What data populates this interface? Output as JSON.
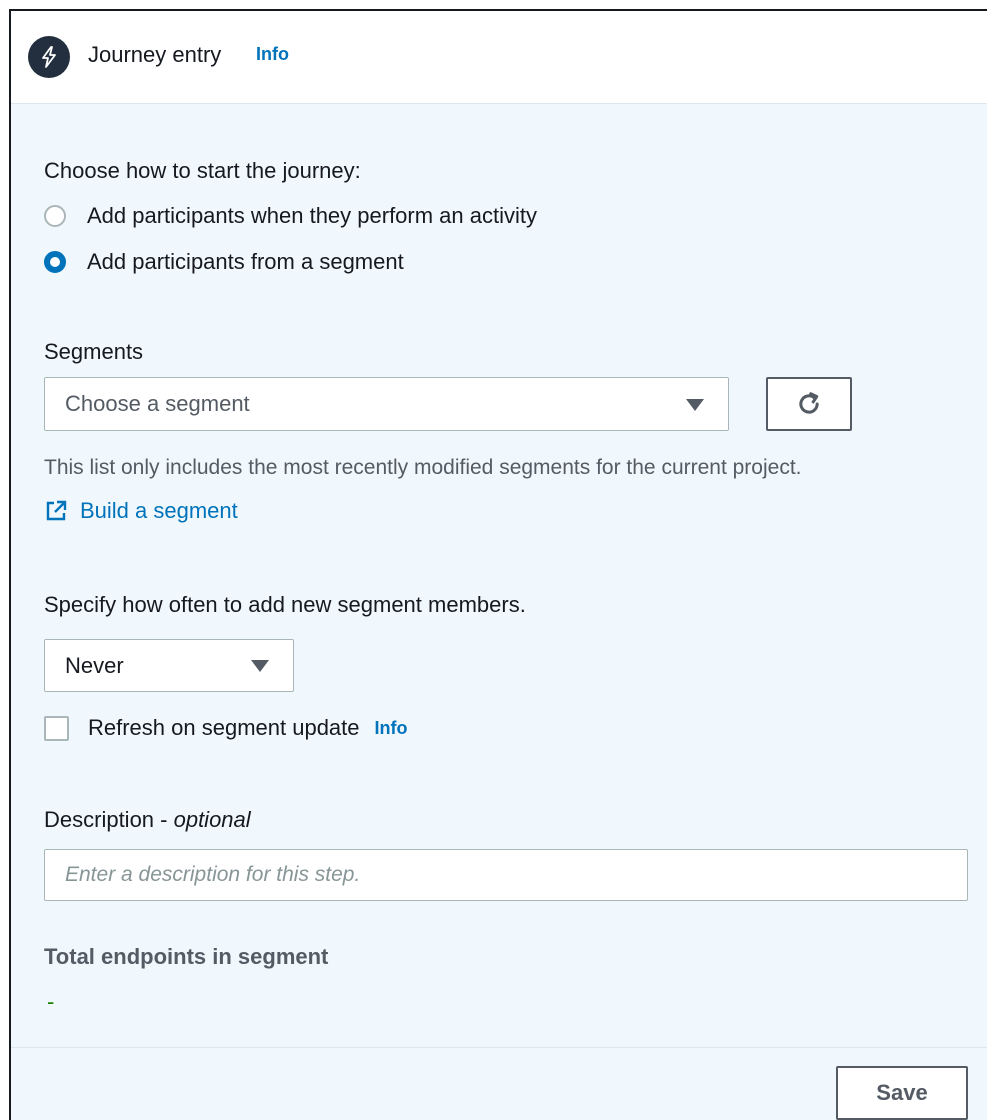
{
  "header": {
    "title": "Journey entry",
    "info_label": "Info",
    "icon": "lightning-icon"
  },
  "start": {
    "prompt": "Choose how to start the journey:",
    "options": [
      {
        "label": "Add participants when they perform an activity",
        "selected": false
      },
      {
        "label": "Add participants from a segment",
        "selected": true
      }
    ]
  },
  "segments": {
    "label": "Segments",
    "select_placeholder": "Choose a segment",
    "hint": "This list only includes the most recently modified segments for the current project.",
    "build_link": "Build a segment"
  },
  "frequency": {
    "label": "Specify how often to add new segment members.",
    "value": "Never"
  },
  "refresh": {
    "label": "Refresh on segment update",
    "info_label": "Info",
    "checked": false
  },
  "description": {
    "label": "Description - ",
    "label_optional": "optional",
    "placeholder": "Enter a description for this step."
  },
  "total": {
    "label": "Total endpoints in segment",
    "value": "-"
  },
  "footer": {
    "save_label": "Save"
  },
  "colors": {
    "accent": "#0073bb",
    "panel_bg": "#f1f8fd",
    "success": "#1d8102"
  }
}
